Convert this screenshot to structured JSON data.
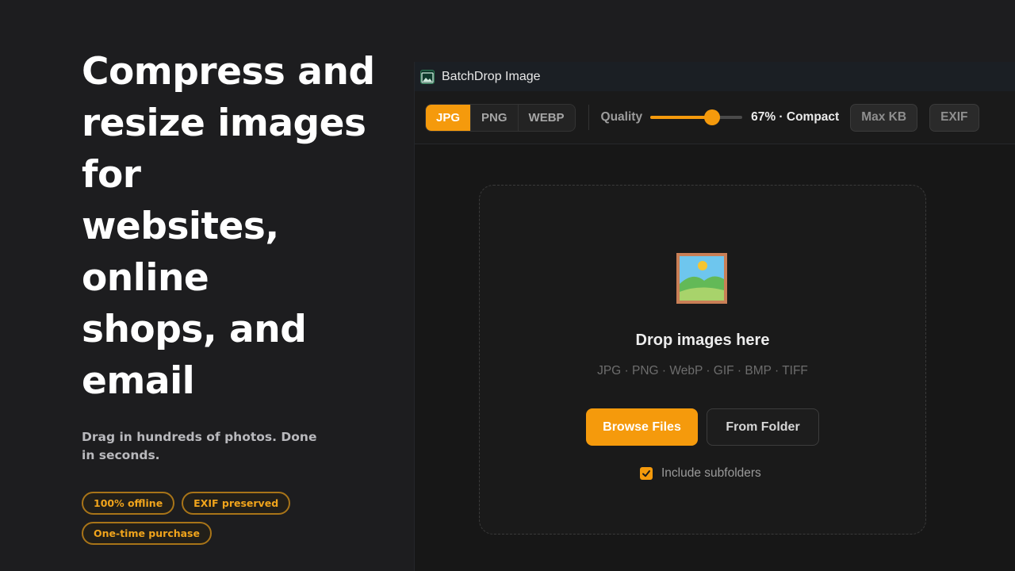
{
  "promo": {
    "headline": "Compress and\nresize images for\nwebsites, online\nshops, and email",
    "subline": "Drag in hundreds of photos. Done in seconds.",
    "badges": [
      "100% offline",
      "EXIF preserved",
      "One-time purchase"
    ]
  },
  "window": {
    "title": "BatchDrop Image",
    "icon": "landscape-photo-icon"
  },
  "toolbar": {
    "formats": [
      "JPG",
      "PNG",
      "WEBP"
    ],
    "selected_format": "JPG",
    "quality_label": "Quality",
    "quality_percent": 67,
    "quality_value_text": "67% · Compact",
    "max_kb_label": "Max KB",
    "exif_label": "EXIF"
  },
  "dropzone": {
    "icon": "framed-picture-icon",
    "title": "Drop images here",
    "formats_text": "JPG · PNG · WebP · GIF · BMP · TIFF",
    "browse_label": "Browse Files",
    "folder_label": "From Folder",
    "subfolders_label": "Include subfolders",
    "subfolders_checked": true
  },
  "colors": {
    "accent": "#f59a0c",
    "background": "#1d1d1f",
    "badge_text": "#f0a41c"
  }
}
